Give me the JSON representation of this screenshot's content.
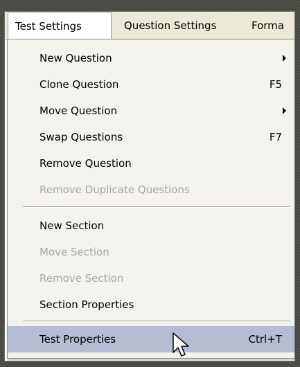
{
  "menubar": {
    "items": [
      {
        "label": "Test Settings"
      },
      {
        "label": "Question Settings"
      },
      {
        "label": "Forma"
      }
    ]
  },
  "menu": {
    "items": [
      {
        "label": "New Question",
        "shortcut": "",
        "submenu": true,
        "enabled": true
      },
      {
        "label": "Clone Question",
        "shortcut": "F5",
        "submenu": false,
        "enabled": true
      },
      {
        "label": "Move Question",
        "shortcut": "",
        "submenu": true,
        "enabled": true
      },
      {
        "label": "Swap Questions",
        "shortcut": "F7",
        "submenu": false,
        "enabled": true
      },
      {
        "label": "Remove Question",
        "shortcut": "",
        "submenu": false,
        "enabled": true
      },
      {
        "label": "Remove Duplicate Questions",
        "shortcut": "",
        "submenu": false,
        "enabled": false
      },
      {
        "label": "New Section",
        "shortcut": "",
        "submenu": false,
        "enabled": true
      },
      {
        "label": "Move Section",
        "shortcut": "",
        "submenu": false,
        "enabled": false
      },
      {
        "label": "Remove Section",
        "shortcut": "",
        "submenu": false,
        "enabled": false
      },
      {
        "label": "Section Properties",
        "shortcut": "",
        "submenu": false,
        "enabled": true
      },
      {
        "label": "Test Properties",
        "shortcut": "Ctrl+T",
        "submenu": false,
        "enabled": true,
        "highlighted": true
      }
    ]
  },
  "colors": {
    "menu_background": "#f4f2ec",
    "highlight": "#b6bdd2",
    "disabled_text": "#a9a8a2"
  },
  "icons": {
    "submenu": "triangle-right-icon",
    "cursor": "mouse-pointer-icon"
  }
}
